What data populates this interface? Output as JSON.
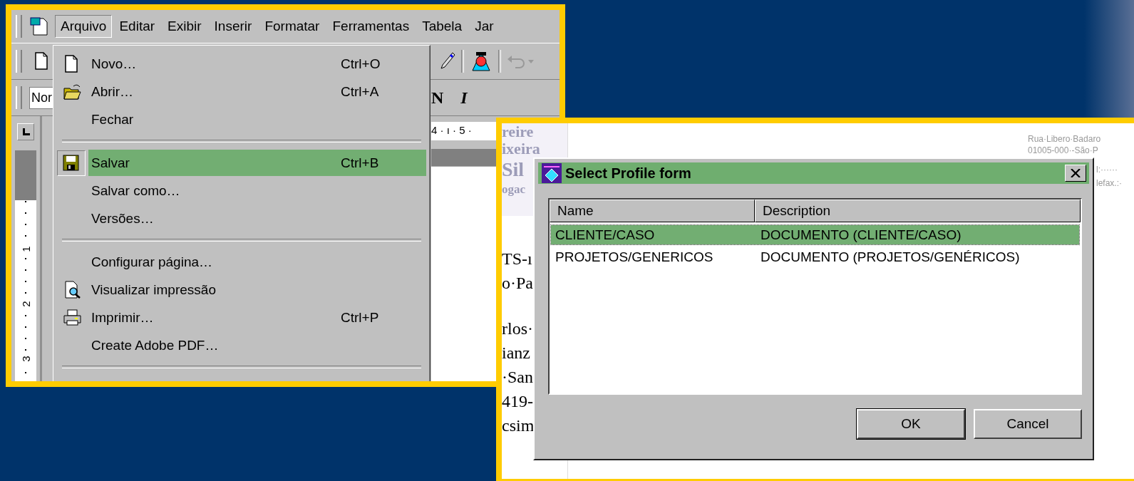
{
  "word_window": {
    "menu_bar": [
      {
        "label": "Arquivo",
        "selected": true
      },
      {
        "label": "Editar",
        "selected": false
      },
      {
        "label": "Exibir",
        "selected": false
      },
      {
        "label": "Inserir",
        "selected": false
      },
      {
        "label": "Formatar",
        "selected": false
      },
      {
        "label": "Ferramentas",
        "selected": false
      },
      {
        "label": "Tabela",
        "selected": false
      },
      {
        "label": "Jar",
        "selected": false
      }
    ],
    "style_field": {
      "value": "Nor"
    },
    "format_buttons": [
      "N",
      "I"
    ],
    "ruler_text": "4 · ı · 5 ·",
    "vertical_ruler_numbers": [
      "1",
      "2",
      "3"
    ],
    "file_menu": [
      {
        "kind": "item",
        "label": "Novo…",
        "shortcut": "Ctrl+O",
        "selected": false
      },
      {
        "kind": "item",
        "label": "Abrir…",
        "shortcut": "Ctrl+A",
        "selected": false
      },
      {
        "kind": "item",
        "label": "Fechar",
        "selected": false
      },
      {
        "kind": "separator"
      },
      {
        "kind": "item",
        "label": "Salvar",
        "shortcut": "Ctrl+B",
        "selected": true
      },
      {
        "kind": "item",
        "label": "Salvar como…",
        "selected": false
      },
      {
        "kind": "item",
        "label": "Versões…",
        "selected": false
      },
      {
        "kind": "separator"
      },
      {
        "kind": "item",
        "label": "Configurar página…",
        "selected": false
      },
      {
        "kind": "item",
        "label": "Visualizar impressão",
        "selected": false
      },
      {
        "kind": "item",
        "label": "Imprimir…",
        "shortcut": "Ctrl+P",
        "selected": false
      },
      {
        "kind": "item",
        "label": "Create Adobe PDF…",
        "selected": false
      },
      {
        "kind": "separator"
      }
    ]
  },
  "document": {
    "letterhead": [
      "reire",
      "ixeira",
      "Sil",
      "ogac"
    ],
    "body_lines": [
      "TS-ı",
      "o·Pa",
      "rlos·",
      "ianz",
      "·San",
      "419-",
      "csim"
    ],
    "address_lines": [
      "Rua·Libero·Badaro",
      "01005-000·-São·P"
    ],
    "contact_lines": [
      "l:······",
      "lefax.:·"
    ]
  },
  "dialog": {
    "title": "Select Profile form",
    "columns": [
      "Name",
      "Description"
    ],
    "rows": [
      {
        "cells": [
          "CLIENTE/CASO",
          "DOCUMENTO (CLIENTE/CASO)"
        ],
        "selected": true
      },
      {
        "cells": [
          "PROJETOS/GENERICOS",
          "DOCUMENTO (PROJETOS/GENÉRICOS)"
        ],
        "selected": false
      }
    ],
    "buttons": [
      {
        "label": "OK",
        "default": true
      },
      {
        "label": "Cancel",
        "default": false
      }
    ]
  }
}
